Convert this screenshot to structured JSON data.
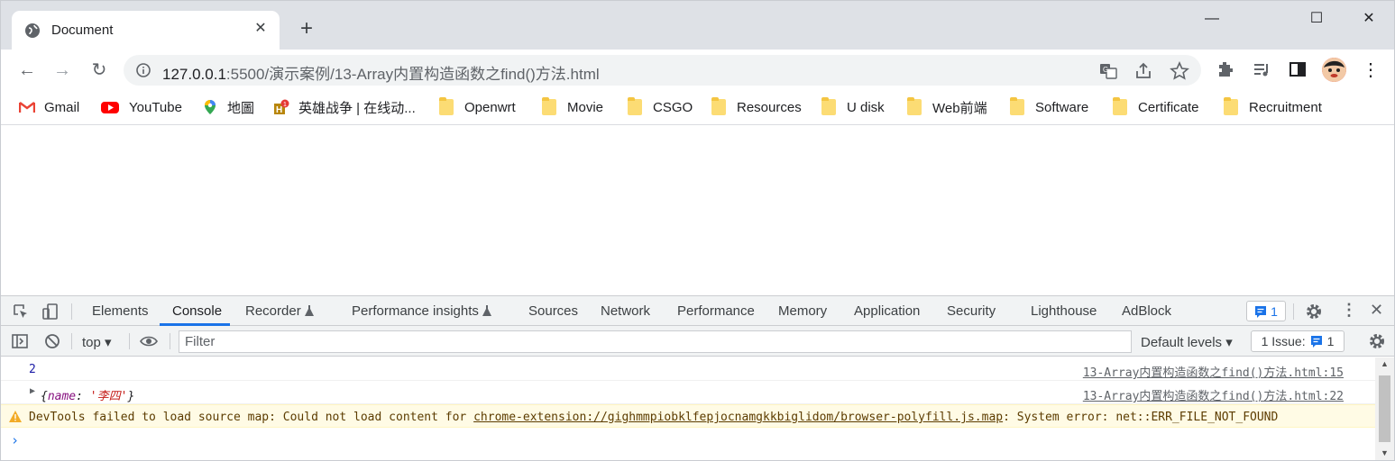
{
  "browser": {
    "tab_title": "Document",
    "url_host": "127.0.0.1",
    "url_rest": ":5500/演示案例/13-Array内置构造函数之find()方法.html"
  },
  "bookmarks": [
    {
      "label": "Gmail",
      "icon": "gmail-icon"
    },
    {
      "label": "YouTube",
      "icon": "youtube-icon"
    },
    {
      "label": "地圖",
      "icon": "maps-icon"
    },
    {
      "label": "英雄战争 | 在线动...",
      "icon": "game-icon"
    },
    {
      "label": "Openwrt",
      "icon": "folder-icon"
    },
    {
      "label": "Movie",
      "icon": "folder-icon"
    },
    {
      "label": "CSGO",
      "icon": "folder-icon"
    },
    {
      "label": "Resources",
      "icon": "folder-icon"
    },
    {
      "label": "U disk",
      "icon": "folder-icon"
    },
    {
      "label": "Web前端",
      "icon": "folder-icon"
    },
    {
      "label": "Software",
      "icon": "folder-icon"
    },
    {
      "label": "Certificate",
      "icon": "folder-icon"
    },
    {
      "label": "Recruitment",
      "icon": "folder-icon"
    }
  ],
  "devtools": {
    "tabs": [
      "Elements",
      "Console",
      "Recorder",
      "Performance insights",
      "Sources",
      "Network",
      "Performance",
      "Memory",
      "Application",
      "Security",
      "Lighthouse",
      "AdBlock"
    ],
    "active_tab": "Console",
    "issue_count": "1",
    "context": "top",
    "filter_placeholder": "Filter",
    "levels": "Default levels",
    "issues_label": "1 Issue:",
    "issues_count": "1"
  },
  "console": {
    "rows": [
      {
        "message": "2",
        "source": "13-Array内置构造函数之find()方法.html:15"
      },
      {
        "message_key": "name",
        "message_value": "'李四'",
        "source": "13-Array内置构造函数之find()方法.html:22"
      }
    ],
    "warning": {
      "prefix": "DevTools failed to load source map: Could not load content for ",
      "link": "chrome-extension://gighmmpiobklfepjocnamgkkbiglidom/browser-polyfill.js.map",
      "suffix": ": System error: net::ERR_FILE_NOT_FOUND"
    },
    "prompt": "›"
  },
  "colors": {
    "accent": "#1a73e8",
    "warning_bg": "#fffbe5",
    "number": "#1a1aa6",
    "string": "#c41a16"
  }
}
